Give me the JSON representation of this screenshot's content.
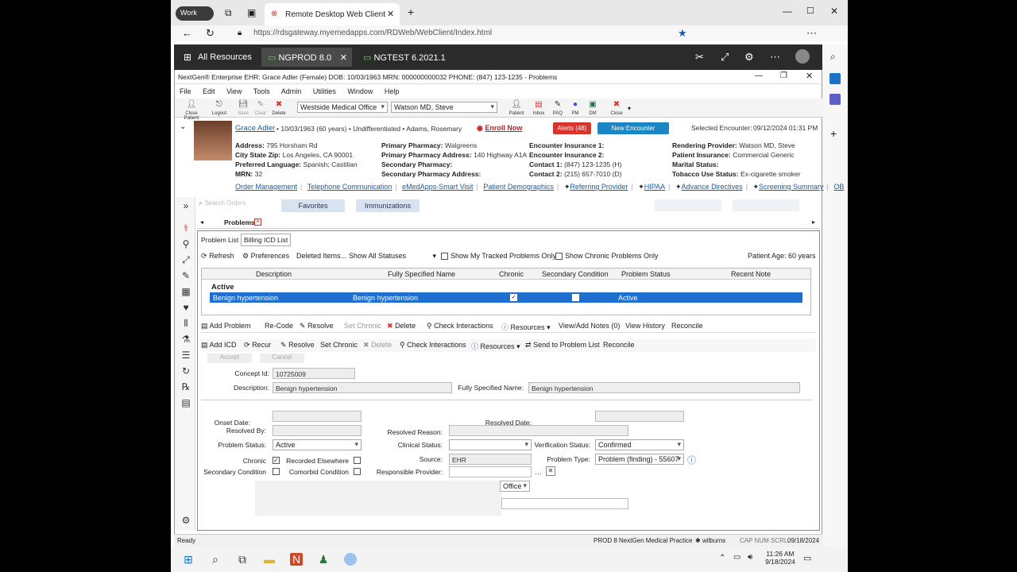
{
  "browser": {
    "profile": "Work",
    "tab_title": "Remote Desktop Web Client",
    "url": "https://rdsgateway.myemedapps.com/RDWeb/WebClient/Index.html"
  },
  "rd": {
    "all_resources": "All Resources",
    "tabs": [
      {
        "label": "NGPROD 8.0"
      },
      {
        "label": "NGTEST 6.2021.1"
      }
    ]
  },
  "app": {
    "title": "NextGen® Enterprise EHR: Grace Adler  (Female)  DOB: 10/03/1963  MRN: 000000000032  PHONE: (847) 123-1235 - Problems",
    "menu": [
      "File",
      "Edit",
      "View",
      "Tools",
      "Admin",
      "Utilities",
      "Window",
      "Help"
    ],
    "toolbar": {
      "close_patient": "Close Patient",
      "logout": "Logout",
      "save": "Save",
      "clear": "Clear",
      "delete": "Delete",
      "location": "Westside Medical Office",
      "provider": "Watson MD, Steve",
      "patient": "Patient",
      "inbox": "Inbox",
      "pao": "PAQ",
      "pm": "PM",
      "dm": "DM",
      "close": "Close"
    },
    "patient": {
      "name": "Grace Adler",
      "summary": "• 10/03/1963 (60 years) • Undifferentiated • Adams, Rosemary",
      "enroll": "Enroll Now",
      "alerts": "Alerts (48)",
      "new_encounter": "New Encounter",
      "selected_encounter_label": "Selected Encounter:",
      "selected_encounter": "09/12/2024 01:31 PM",
      "col1": [
        {
          "label": "Address:",
          "value": "795 Horsham Rd"
        },
        {
          "label": "City State Zip:",
          "value": "Los Angeles, CA 90001"
        },
        {
          "label": "Preferred Language:",
          "value": "Spanish; Castilian"
        },
        {
          "label": "MRN:",
          "value": "32"
        }
      ],
      "col2": [
        {
          "label": "Primary Pharmacy:",
          "value": "Walgreens"
        },
        {
          "label": "Primary Pharmacy Address:",
          "value": "140 Highway A1A"
        },
        {
          "label": "Secondary Pharmacy:",
          "value": ""
        },
        {
          "label": "Secondary Pharmacy Address:",
          "value": ""
        }
      ],
      "col3": [
        {
          "label": "Encounter Insurance 1:",
          "value": ""
        },
        {
          "label": "Encounter Insurance 2:",
          "value": ""
        },
        {
          "label": "Contact 1:",
          "value": "(847) 123-1235 (H)"
        },
        {
          "label": "Contact 2:",
          "value": "(215) 657-7010 (D)"
        }
      ],
      "col4": [
        {
          "label": "Rendering Provider:",
          "value": "Watson MD, Steve"
        },
        {
          "label": "Patient Insurance:",
          "value": "Commercial Generic"
        },
        {
          "label": "Marital Status:",
          "value": ""
        },
        {
          "label": "Tobacco Use Status:",
          "value": "Ex-cigarette smoker"
        }
      ],
      "links": [
        "Order Management",
        "Telephone Communication",
        "eMedApps-Smart Visit",
        "Patient Demographics",
        "Referring Provider",
        "HIPAA",
        "Advance Directives",
        "Screening Summary",
        "OB"
      ]
    },
    "search_orders": "Search Orders",
    "favorites": "Favorites",
    "immunizations": "Immunizations",
    "problems_tab": "Problems",
    "subtabs": [
      "Problem List",
      "Billing ICD List"
    ],
    "list_toolbar": {
      "refresh": "Refresh",
      "preferences": "Preferences",
      "deleted_items": "Deleted Items...",
      "status_filter": "Show All Statuses",
      "tracked": "Show My Tracked Problems Only",
      "chronic_only": "Show Chronic Problems Only",
      "age": "Patient Age: 60 years"
    },
    "grid": {
      "headers": [
        "Description",
        "Fully Specified Name",
        "Chronic",
        "Secondary Condition",
        "Problem Status",
        "Recent Note"
      ],
      "group": "Active",
      "row": {
        "description": "Benign hypertension",
        "fsn": "Benign hypertension",
        "status": "Active"
      }
    },
    "actions1": [
      "Add Problem",
      "Re-Code",
      "Resolve",
      "Set Chronic",
      "Delete",
      "Check Interactions",
      "Resources",
      "View/Add Notes (0)",
      "View History",
      "Reconcile"
    ],
    "actions2": [
      "Add ICD",
      "Recur",
      "Resolve",
      "Set Chronic",
      "Delete",
      "Check Interactions",
      "Resources",
      "Send to Problem List",
      "Reconcile"
    ],
    "form": {
      "accept": "Accept",
      "cancel": "Cancel",
      "concept_id_label": "Concept Id:",
      "concept_id": "10725009",
      "description_label": "Description:",
      "description": "Benign hypertension",
      "fsn_label": "Fully Specified Name:",
      "fsn": "Benign hypertension",
      "onset_date_label": "Onset Date:",
      "resolved_date_label": "Resolved Date:",
      "resolved_by_label": "Resolved By:",
      "resolved_reason_label": "Resolved Reason:",
      "problem_status_label": "Problem Status:",
      "problem_status": "Active",
      "clinical_status_label": "Clinical Status:",
      "verification_status_label": "Verification Status:",
      "verification_status": "Confirmed",
      "chronic_label": "Chronic",
      "recorded_elsewhere_label": "Recorded Elsewhere",
      "source_label": "Source:",
      "source": "EHR",
      "problem_type_label": "Problem Type:",
      "problem_type": "Problem (finding) - 55607",
      "secondary_condition_label": "Secondary Condition",
      "comorbid_label": "Comorbid Condition",
      "responsible_provider_label": "Responsible Provider:",
      "office_value": "Office"
    },
    "status": {
      "ready": "Ready",
      "env": "PROD 8",
      "practice": "NextGen Medical Practice",
      "user": "wilburns",
      "keys": "CAP  NUM  SCRL",
      "date": "09/18/2024"
    }
  },
  "taskbar": {
    "time": "11:26 AM",
    "date": "9/18/2024"
  }
}
